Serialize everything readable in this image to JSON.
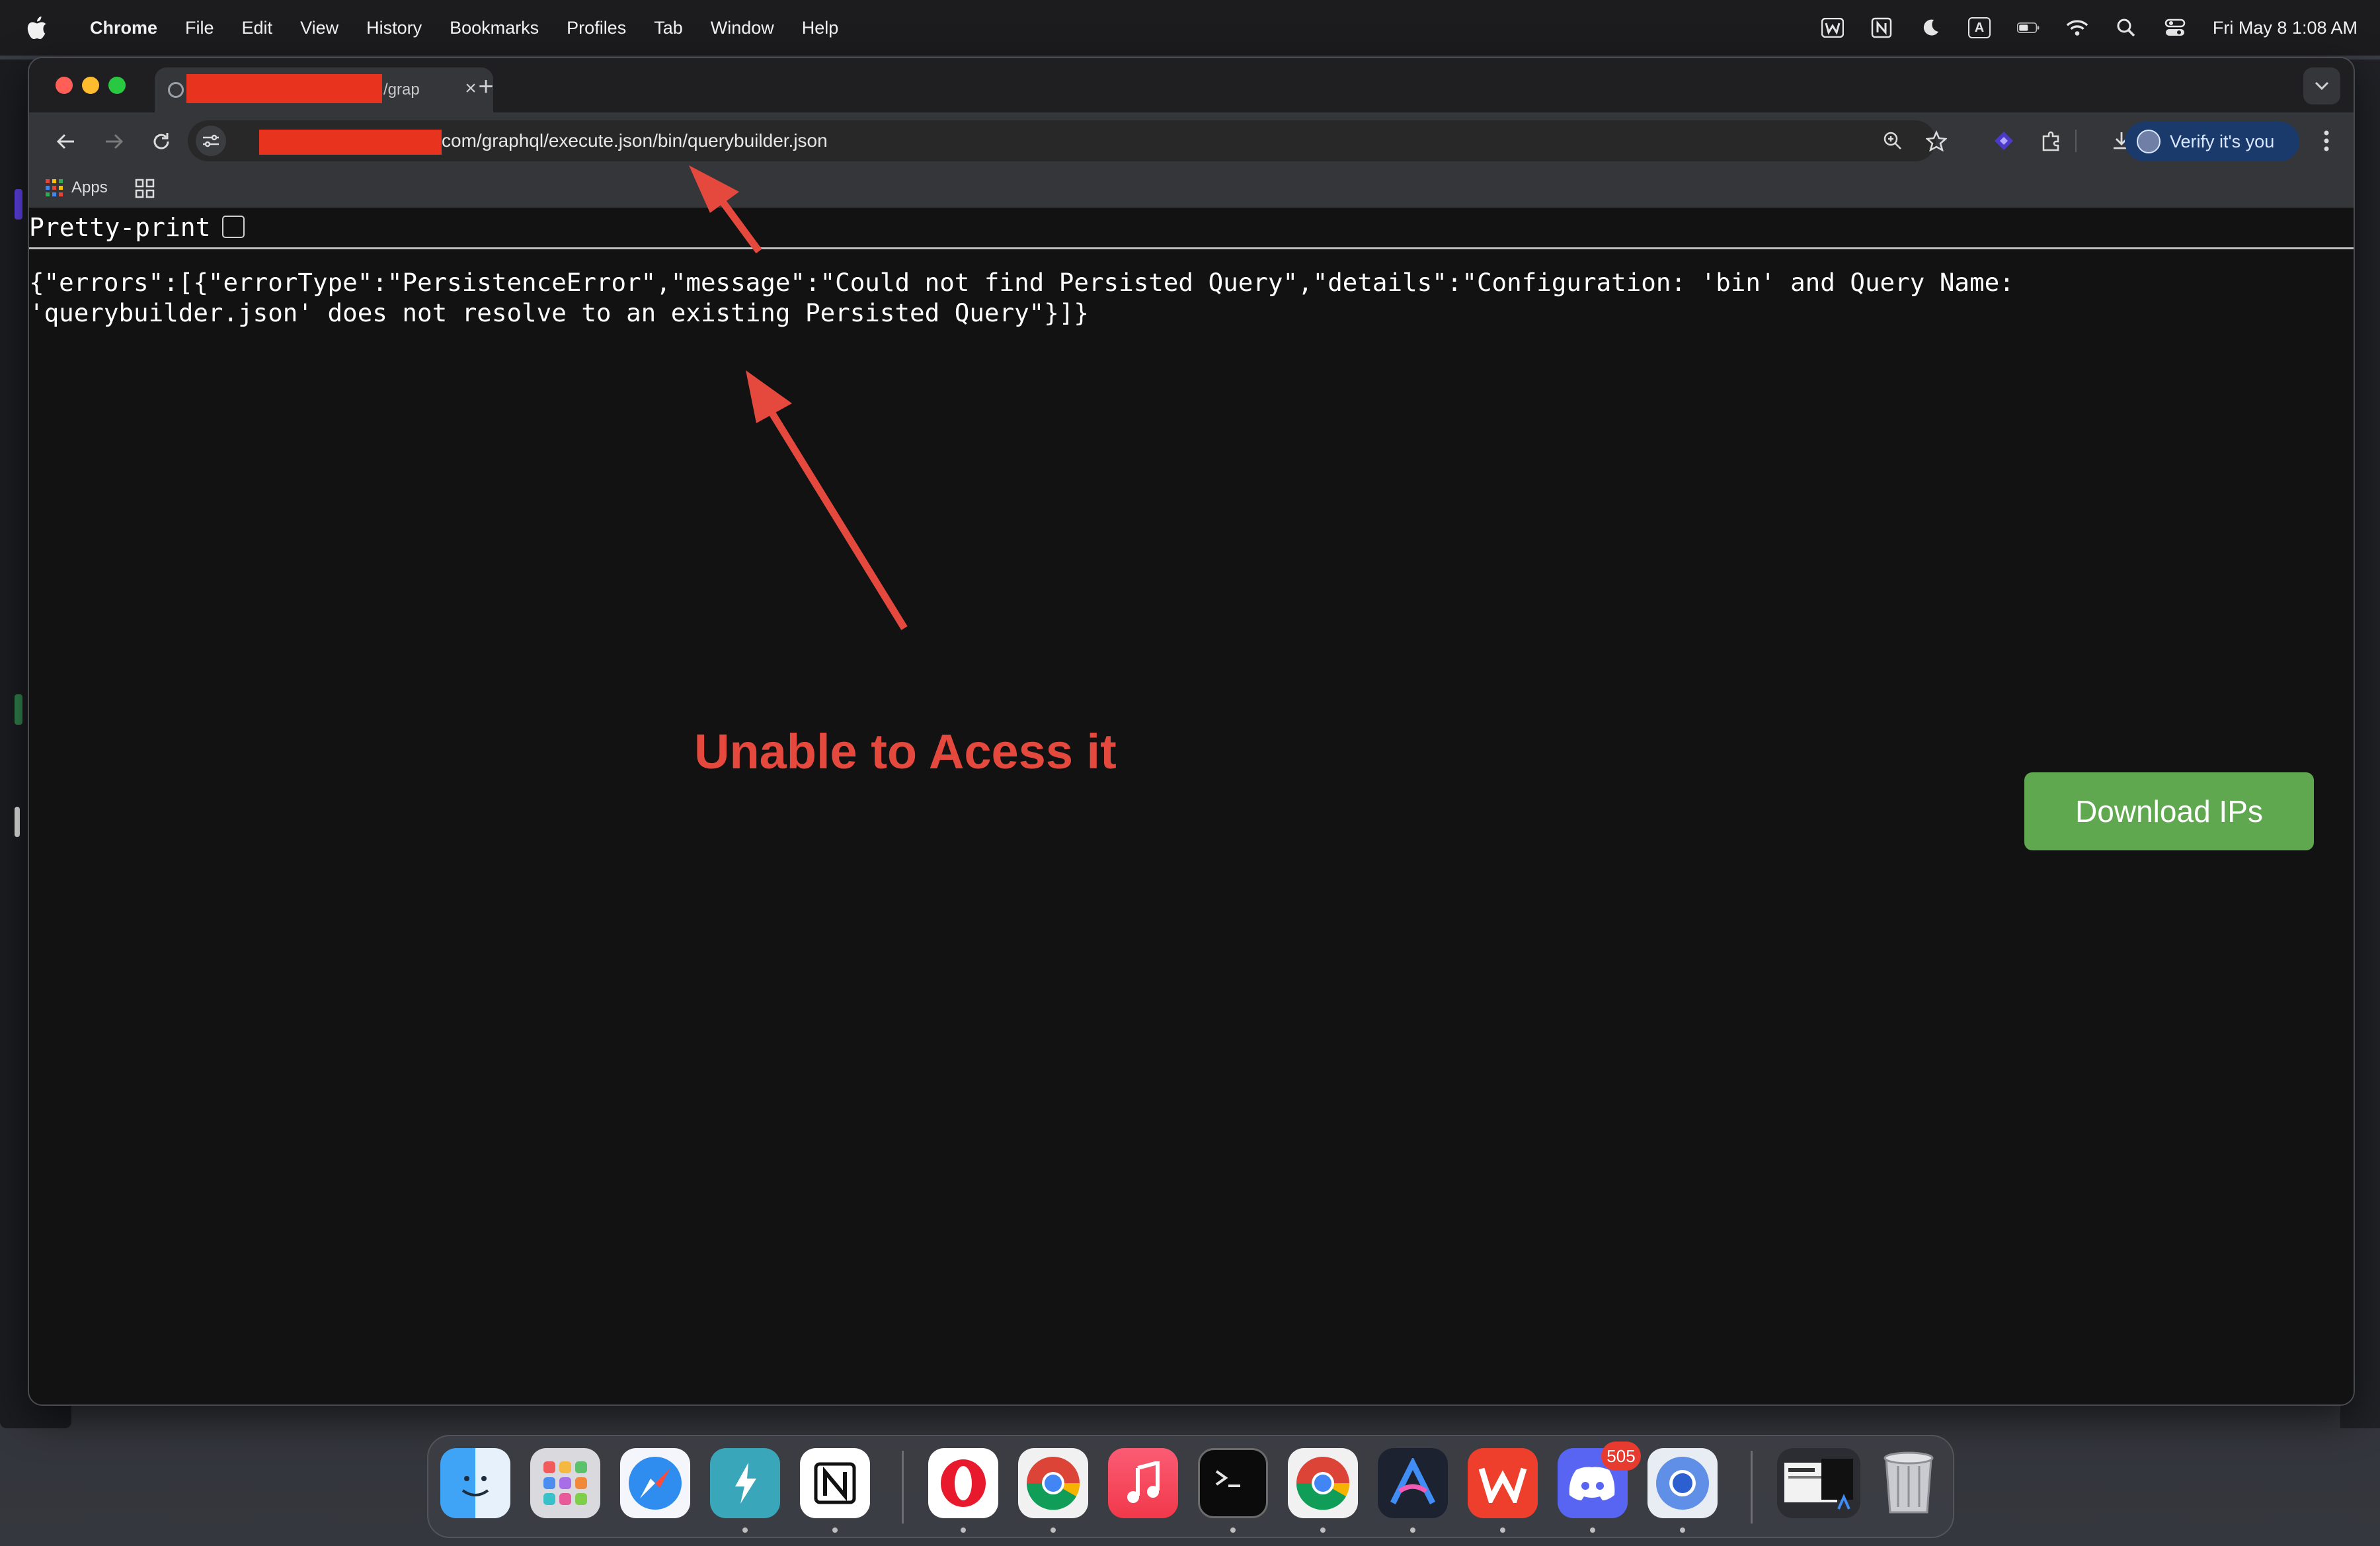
{
  "menubar": {
    "app_name": "Chrome",
    "menus": [
      "File",
      "Edit",
      "View",
      "History",
      "Bookmarks",
      "Profiles",
      "Tab",
      "Window",
      "Help"
    ],
    "status_icons": [
      "wps-icon",
      "notion-icon",
      "moon-icon",
      "input-source-icon",
      "battery-icon",
      "wifi-icon",
      "spotlight-icon",
      "control-center-icon"
    ],
    "input_source_letter": "A",
    "clock": "Fri May 8  1:08 AM"
  },
  "browser": {
    "tab": {
      "title": "/grap",
      "close_glyph": "×"
    },
    "new_tab_glyph": "+",
    "address": {
      "url_visible": "com/graphql/execute.json/bin/querybuilder.json"
    },
    "profile_chip_label": "Verify it's you",
    "bookmarks": {
      "apps_label": "Apps"
    }
  },
  "page": {
    "pretty_print_label": "Pretty-print",
    "pretty_print_checked": false,
    "json_line_1": "{\"errors\":[{\"errorType\":\"PersistenceError\",\"message\":\"Could not find Persisted Query\",\"details\":\"Configuration: 'bin' and Query Name:",
    "json_line_2": "'querybuilder.json' does not resolve to an existing Persisted Query\"}]}",
    "annotation_text": "Unable to Acess it",
    "download_button_label": "Download IPs"
  },
  "colors": {
    "redaction": "#e8331f",
    "annotation": "#e5483d",
    "download_button": "#5fa84f",
    "profile_chip": "#1a3a6b"
  },
  "dock": {
    "apps": [
      "finder",
      "launchpad",
      "safari",
      "topnotch",
      "notion",
      "opera",
      "chrome",
      "music",
      "terminal",
      "chrome-alt",
      "arc-like",
      "wps-office",
      "discord",
      "chromium",
      "window-preview",
      "trash"
    ],
    "discord_badge": "505"
  }
}
